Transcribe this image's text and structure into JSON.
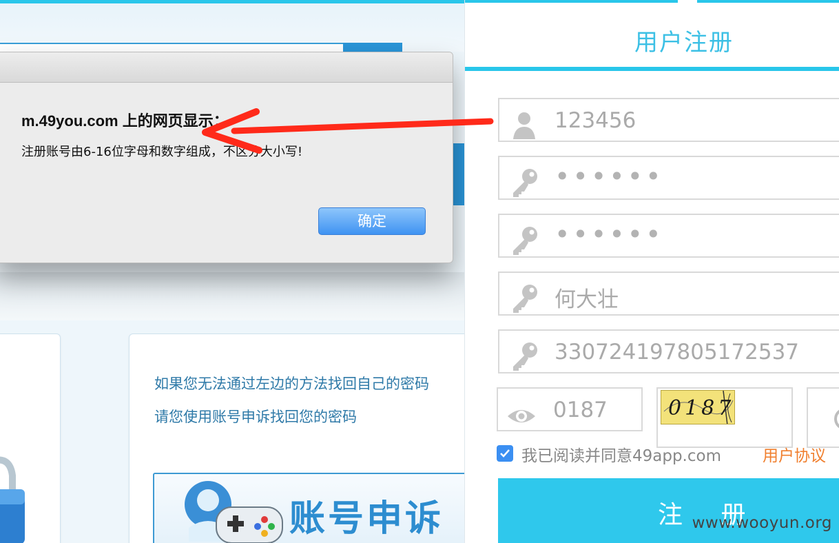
{
  "background_page": {
    "card_text_line1": "如果您无法通过左边的方法找回自己的密码",
    "card_text_line2": "请您使用账号申诉找回您的密码",
    "appeal_banner_text": "账号申诉"
  },
  "dialog": {
    "heading": "m.49you.com 上的网页显示：",
    "message": "注册账号由6-16位字母和数字组成，不区分大小写!",
    "ok_label": "确定"
  },
  "registration": {
    "title": "用户注册",
    "fields": [
      {
        "name": "username",
        "icon": "user-icon",
        "value": "123456"
      },
      {
        "name": "password",
        "icon": "key-icon",
        "value": "••••••"
      },
      {
        "name": "confirm_password",
        "icon": "key-icon",
        "value": "••••••"
      },
      {
        "name": "real_name",
        "icon": "key-icon",
        "value": "何大壮"
      },
      {
        "name": "id_number",
        "icon": "key-icon",
        "value": "330724197805172537"
      }
    ],
    "captcha": {
      "icon": "eye-icon",
      "value": "0187",
      "image_text": "0187"
    },
    "agreement": {
      "checked": true,
      "text": "我已阅读并同意49app.com",
      "link_text": "用户协议"
    },
    "submit_label": "注 册"
  },
  "watermark": "www.wooyun.org",
  "colors": {
    "accent_cyan": "#29c6ea",
    "title_text": "#3cc0e5",
    "dialog_button": "#3f93f2",
    "link_orange": "#f07f2e",
    "arrow_red": "#ff2a1a"
  }
}
